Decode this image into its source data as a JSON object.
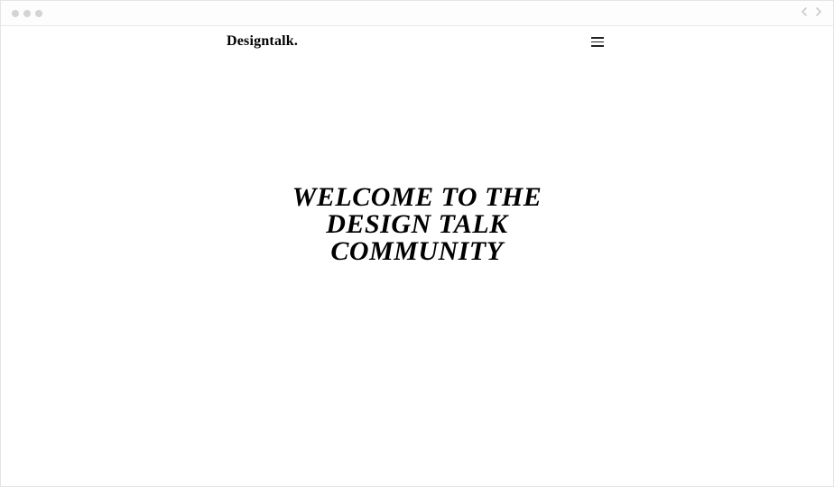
{
  "header": {
    "brand": "Designtalk."
  },
  "hero": {
    "title": "WELCOME TO THE\nDESIGN TALK\nCOMMUNITY"
  }
}
